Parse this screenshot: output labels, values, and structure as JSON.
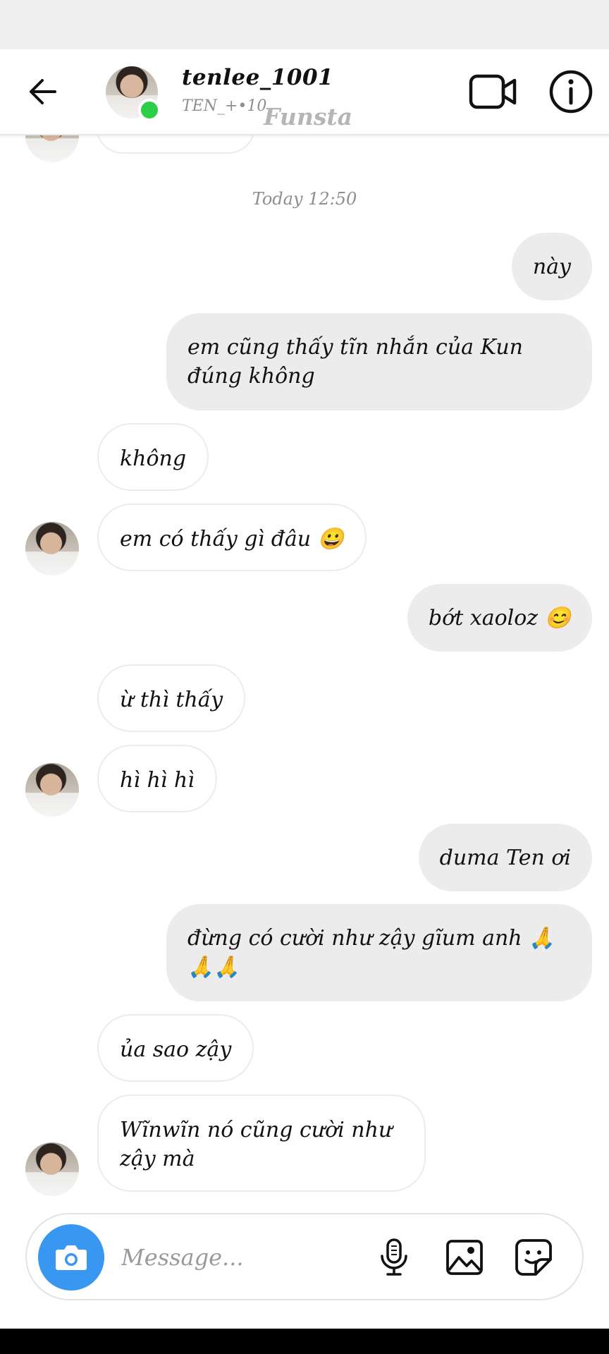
{
  "header": {
    "username": "tenlee_1001",
    "subtitle": "TEN_+•10",
    "watermark": "Funsta"
  },
  "chat": {
    "previous_time": "",
    "timestamp": "Today 12:50",
    "messages": [
      {
        "from": "me",
        "text": "này"
      },
      {
        "from": "me",
        "text": "em cũng thấy tĩn nhắn của Kun đúng không"
      },
      {
        "from": "them",
        "text": "không"
      },
      {
        "from": "them",
        "text": "em có thấy gì đâu 😀"
      },
      {
        "from": "me",
        "text": "bớt xaoloz 😊"
      },
      {
        "from": "them",
        "text": "ừ thì thấy"
      },
      {
        "from": "them",
        "text": "hì hì hì"
      },
      {
        "from": "me",
        "text": "duma Ten ơi"
      },
      {
        "from": "me",
        "text": "đừng có cười như zậy gĩum anh 🙏🙏🙏"
      },
      {
        "from": "them",
        "text": "ủa sao zậy"
      },
      {
        "from": "them",
        "text": "Wĩnwĩn nó cũng cười như zậy mà"
      }
    ]
  },
  "composer": {
    "placeholder": "Message..."
  },
  "colors": {
    "accent": "#3897f0",
    "online": "#2bd046",
    "outgoing_bubble": "#ececec"
  },
  "icons": [
    "back-arrow-icon",
    "video-call-icon",
    "info-icon",
    "camera-icon",
    "microphone-icon",
    "gallery-icon",
    "sticker-icon"
  ]
}
